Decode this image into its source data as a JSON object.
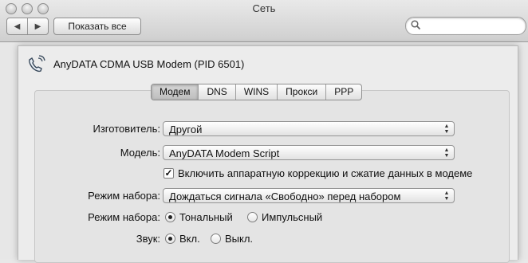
{
  "window": {
    "title": "Сеть"
  },
  "toolbar": {
    "back_icon": "◀",
    "forward_icon": "▶",
    "show_all_label": "Показать все",
    "search_placeholder": ""
  },
  "sheet": {
    "device_name": "AnyDATA CDMA USB Modem (PID 6501)",
    "tabs": [
      {
        "label": "Модем",
        "active": true
      },
      {
        "label": "DNS",
        "active": false
      },
      {
        "label": "WINS",
        "active": false
      },
      {
        "label": "Прокси",
        "active": false
      },
      {
        "label": "PPP",
        "active": false
      }
    ],
    "manufacturer": {
      "label": "Изготовитель:",
      "value": "Другой"
    },
    "model": {
      "label": "Модель:",
      "value": "AnyDATA Modem Script"
    },
    "hw_compression": {
      "label": "Включить аппаратную коррекцию и сжатие данных в модеме",
      "checked": true
    },
    "dial_mode": {
      "label": "Режим набора:",
      "value": "Дождаться сигнала «Свободно» перед набором"
    },
    "dialing": {
      "label": "Режим набора:",
      "options": [
        "Тональный",
        "Импульсный"
      ],
      "selected": "Тональный"
    },
    "sound": {
      "label": "Звук:",
      "options": [
        "Вкл.",
        "Выкл."
      ],
      "selected": "Вкл."
    }
  }
}
